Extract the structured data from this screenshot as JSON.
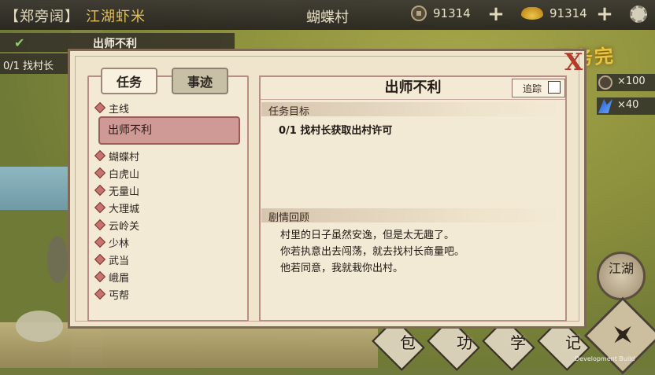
{
  "topbar": {
    "player_name": "【郑旁阔】",
    "player_title": "江湖虾米",
    "location": "蝴蝶村",
    "coins": "91314",
    "ingots": "91314",
    "plus_label": "+"
  },
  "tracker": {
    "task_title": "出师不利",
    "task_progress": "0/1 找村长"
  },
  "notice": {
    "complete_text": "任务完成！"
  },
  "rewards": [
    {
      "icon": "coin-icon",
      "text": "×100"
    },
    {
      "icon": "flag-icon",
      "text": "×40"
    }
  ],
  "modal": {
    "tabs": [
      "任务",
      "事迹"
    ],
    "close_label": "X",
    "sections": [
      {
        "label": "主线"
      },
      {
        "label": "蝴蝶村"
      },
      {
        "label": "白虎山"
      },
      {
        "label": "无量山"
      },
      {
        "label": "大理城"
      },
      {
        "label": "云岭关"
      },
      {
        "label": "少林"
      },
      {
        "label": "武当"
      },
      {
        "label": "峨眉"
      },
      {
        "label": "丐帮"
      }
    ],
    "selected_task": "出师不利",
    "detail": {
      "title": "出师不利",
      "track_label": "追踪",
      "goal_header": "任务目标",
      "goal_text": "0/1 找村长获取出村许可",
      "story_header": "剧情回顾",
      "story_lines": [
        "村里的日子虽然安逸，但是太无趣了。",
        "你若执意出去闯荡，就去找村长商量吧。",
        "他若同意，我就栽你出村。"
      ]
    }
  },
  "bottom_menu": [
    "包",
    "功",
    "学",
    "记"
  ],
  "jianghu_button": "江湖",
  "dev_build": "Development Build"
}
